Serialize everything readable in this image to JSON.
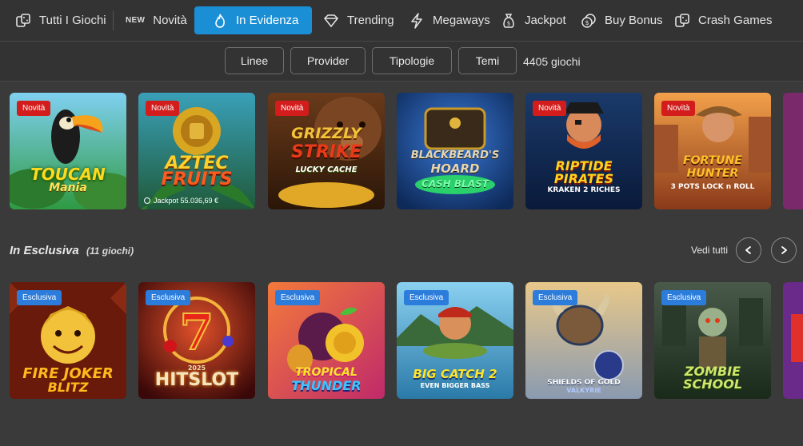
{
  "nav": {
    "items": [
      {
        "label": "Tutti I Giochi",
        "icon": "dice-icon"
      },
      {
        "badge": "NEW",
        "label": "Novità"
      },
      {
        "label": "In Evidenza",
        "icon": "flame-icon",
        "active": true
      },
      {
        "label": "Trending",
        "icon": "diamond-icon"
      },
      {
        "label": "Megaways",
        "icon": "lightning-icon"
      },
      {
        "label": "Jackpot",
        "icon": "money-bag-icon"
      },
      {
        "label": "Buy Bonus",
        "icon": "coins-icon"
      },
      {
        "label": "Crash Games",
        "icon": "dice-icon"
      }
    ],
    "active_color": "#1a8fd6"
  },
  "filters": {
    "buttons": [
      "Linee",
      "Provider",
      "Tipologie",
      "Temi"
    ],
    "count": "4405 giochi"
  },
  "featured": {
    "tiles": [
      {
        "badge": "Novità",
        "title": "TOUCAN",
        "subtitle": "Mania"
      },
      {
        "badge": "Novità",
        "title": "AZTEC",
        "subtitle": "FRUITS",
        "jackpot": "Jackpot 55.036,69 €"
      },
      {
        "badge": "Novità",
        "title": "GRIZZLY",
        "subtitle": "STRIKE",
        "tag": "LUCKY CACHE"
      },
      {
        "title": "BLACKBEARD'S",
        "subtitle": "HOARD",
        "tag": "CASH BLAST"
      },
      {
        "badge": "Novità",
        "title": "RIPTIDE",
        "subtitle": "PIRATES",
        "tag": "KRAKEN 2 RICHES"
      },
      {
        "badge": "Novità",
        "title": "FORTUNE",
        "subtitle": "HUNTER",
        "tag": "3 POTS LOCK n ROLL"
      }
    ]
  },
  "exclusive": {
    "title": "In Esclusiva",
    "count": "(11 giochi)",
    "see_all": "Vedi tutti",
    "tiles": [
      {
        "badge": "Esclusiva",
        "title": "FIRE JOKER",
        "subtitle": "BLITZ"
      },
      {
        "badge": "Esclusiva",
        "title": "HITSLOT",
        "subtitle": "2025"
      },
      {
        "badge": "Esclusiva",
        "title": "TROPICAL",
        "subtitle": "THUNDER"
      },
      {
        "badge": "Esclusiva",
        "title": "BIG CATCH 2",
        "subtitle": "EVEN BIGGER BASS"
      },
      {
        "badge": "Esclusiva",
        "title": "SHIELDS OF GOLD",
        "subtitle": "VALKYRIE"
      },
      {
        "badge": "Esclusiva",
        "title": "ZOMBIE",
        "subtitle": "SCHOOL"
      }
    ]
  }
}
